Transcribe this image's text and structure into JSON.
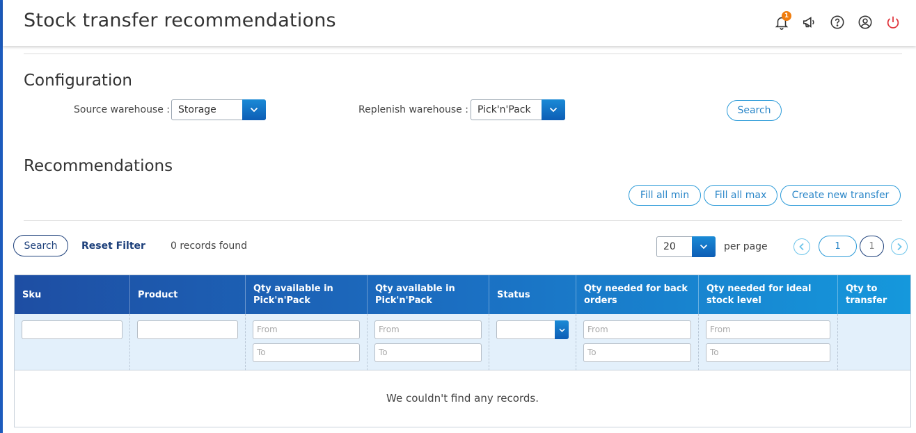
{
  "header": {
    "title": "Stock transfer recommendations",
    "notification_count": "1",
    "icons": [
      "bell-icon",
      "megaphone-icon",
      "help-icon",
      "user-icon",
      "power-icon"
    ]
  },
  "configuration": {
    "title": "Configuration",
    "source_label": "Source warehouse :",
    "source_value": "Storage",
    "replenish_label": "Replenish warehouse :",
    "replenish_value": "Pick'n'Pack",
    "search_label": "Search"
  },
  "recommendations": {
    "title": "Recommendations",
    "fill_min_label": "Fill all min",
    "fill_max_label": "Fill all max",
    "create_transfer_label": "Create new transfer"
  },
  "toolbar": {
    "search_label": "Search",
    "reset_label": "Reset Filter",
    "records_text": "0 records found",
    "per_page_value": "20",
    "per_page_label": "per page",
    "current_page": "1",
    "total_pages": "1"
  },
  "table": {
    "columns": [
      "Sku",
      "Product",
      "Qty available in Pick'n'Pack",
      "Qty available in Pick'n'Pack",
      "Status",
      "Qty needed for back orders",
      "Qty needed for ideal stock level",
      "Qty to transfer"
    ],
    "from_placeholder": "From",
    "to_placeholder": "To",
    "empty_message": "We couldn't find any records."
  },
  "colors": {
    "accent": "#1a8ad6",
    "header_gradient_start": "#1e4ea3",
    "header_gradient_end": "#1598dc",
    "badge": "#f07d0e",
    "power": "#e0333a"
  }
}
